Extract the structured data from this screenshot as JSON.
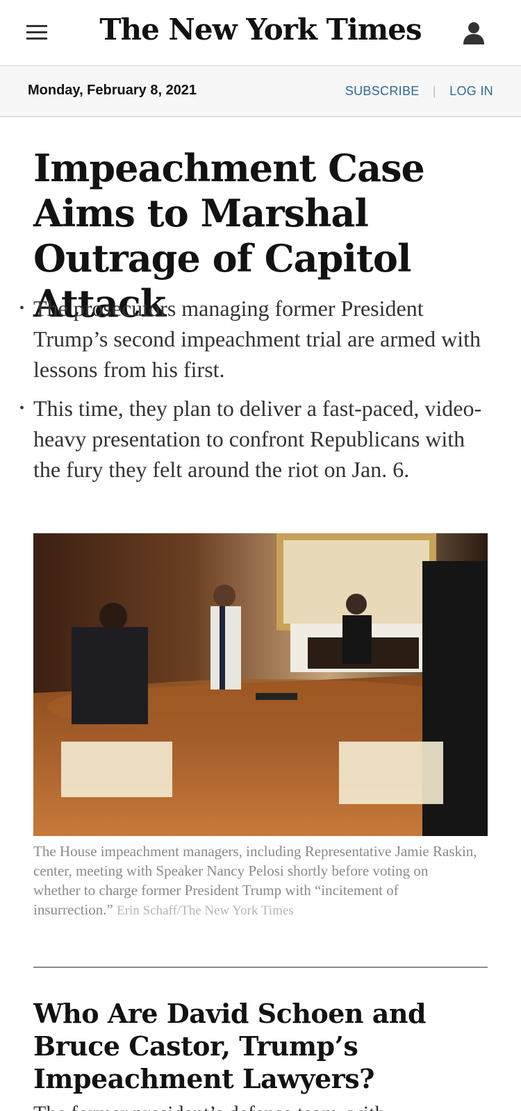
{
  "header": {
    "logo": "The New York Times",
    "menu_icon": "hamburger-menu-icon",
    "account_icon": "user-account-icon"
  },
  "datebar": {
    "date": "Monday, February 8, 2021",
    "subscribe": "SUBSCRIBE",
    "login": "LOG IN"
  },
  "lead": {
    "headline": "Impeachment Case Aims to Marshal Outrage of Capitol Attack",
    "bullets": [
      "The prosecutors managing former President Trump’s second impeachment trial are armed with lessons from his first.",
      "This time, they plan to deliver a fast-paced, video-heavy presentation to confront Republicans with the fury they felt around the riot on Jan. 6."
    ],
    "caption": "The House impeachment managers, including Representative Jamie Raskin, center, meeting with Speaker Nancy Pelosi shortly before voting on whether to charge former President Trump with “incitement of insurrection.”",
    "credit": "Erin Schaff/The New York Times"
  },
  "second": {
    "headline": "Who Are David Schoen and Bruce Castor, Trump’s Impeachment Lawyers?",
    "summary": "The former president’s defense team, with"
  },
  "colors": {
    "link_blue": "#326891",
    "text": "#121212"
  }
}
